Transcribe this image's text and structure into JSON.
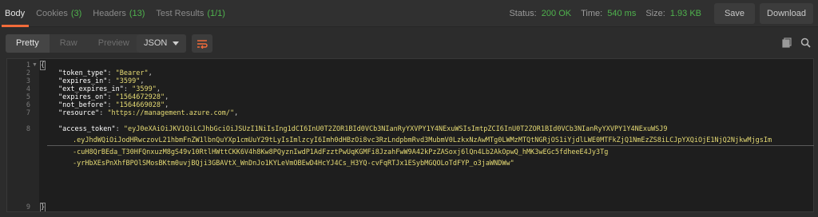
{
  "tabs": [
    {
      "label": "Body",
      "count": ""
    },
    {
      "label": "Cookies",
      "count": "(3)"
    },
    {
      "label": "Headers",
      "count": "(13)"
    },
    {
      "label": "Test Results",
      "count": "(1/1)"
    }
  ],
  "status": {
    "status_label": "Status:",
    "status_value": "200 OK",
    "time_label": "Time:",
    "time_value": "540 ms",
    "size_label": "Size:",
    "size_value": "1.93 KB"
  },
  "buttons": {
    "save": "Save",
    "download": "Download"
  },
  "view_modes": [
    "Pretty",
    "Raw",
    "Preview"
  ],
  "format": "JSON",
  "colors": {
    "accent": "#f26b3a",
    "success": "#4fb24d",
    "string": "#e6db74"
  },
  "code": {
    "line_numbers": [
      "1",
      "2",
      "3",
      "4",
      "5",
      "6",
      "7",
      "8",
      "9"
    ],
    "open_brace": "{",
    "close_brace": "}",
    "lines": [
      {
        "key": "\"token_type\"",
        "value": "\"Bearer\"",
        "comma": ","
      },
      {
        "key": "\"expires_in\"",
        "value": "\"3599\"",
        "comma": ","
      },
      {
        "key": "\"ext_expires_in\"",
        "value": "\"3599\"",
        "comma": ","
      },
      {
        "key": "\"expires_on\"",
        "value": "\"1564672928\"",
        "comma": ","
      },
      {
        "key": "\"not_before\"",
        "value": "\"1564669028\"",
        "comma": ","
      },
      {
        "key": "\"resource\"",
        "value": "\"https://management.azure.com/\"",
        "comma": ","
      },
      {
        "key": "\"access_token\"",
        "value": "\"eyJ0eXAiOiJKV1QiLCJhbGciOiJSUzI1NiIsIng1dCI6InU0T2ZOR1BId0VCb3NIanRyYXVPY1Y4NExuWSIsImtpZCI6InU0T2ZOR1BId0VCb3NIanRyYXVPY1Y4NExuWSJ9",
        "comma": ""
      }
    ],
    "token_continuation": [
      ".eyJhdWQiOiJodHRwczovL21hbmFnZW1lbnQuYXp1cmUuY29tLyIsImlzcyI6Imh0dHBzOi8vc3RzLndpbmRvd3MubmV0LzkxNzAwMTg0LWMzMTQtNGRjOS1iYjdlLWE0MTFkZjQ1NmEzZS8iLCJpYXQiOjE1NjQ2NjkwMjgsIm",
      "-cuH8QrBEda_T30HFQnxuzM8gS49v10RtlHWttCKK6V4h8Kw8PQyznIwdP1AdFzztPwUqKGMFi8JzahFwW9A42kPzZASoxj6lQn4Lb2AkOpwQ_hMK3wEGc5fdheeE4Jy3Tg",
      "-yrHbXEsPnXhfBPOlSMosBKtm0uvjBQji3GBAVtX_WnDnJo1KYLeVmOBEwD4HcYJ4Cs_H3YQ-cvFqRTJx1ESybMGQOLoTdFYP_o3jaWNDWw\""
    ]
  }
}
